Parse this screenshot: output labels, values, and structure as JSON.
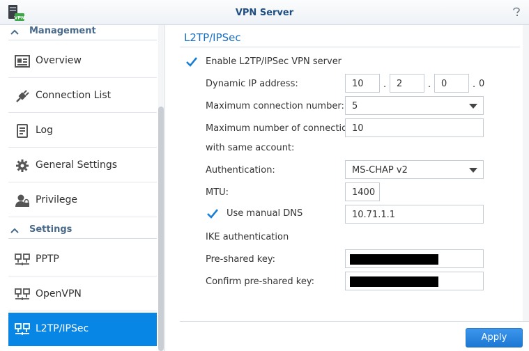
{
  "window": {
    "title": "VPN Server",
    "app_icon_text": "VPN"
  },
  "sidebar": {
    "groups": [
      {
        "label": "Management"
      },
      {
        "label": "Settings"
      }
    ],
    "items": [
      {
        "label": "Overview"
      },
      {
        "label": "Connection List"
      },
      {
        "label": "Log"
      },
      {
        "label": "General Settings"
      },
      {
        "label": "Privilege"
      },
      {
        "label": "PPTP"
      },
      {
        "label": "OpenVPN"
      },
      {
        "label": "L2TP/IPSec"
      }
    ],
    "active_item": "L2TP/IPSec"
  },
  "form": {
    "section_title": "L2TP/IPSec",
    "enable_label": "Enable L2TP/IPSec VPN server",
    "enable_checked": true,
    "dynamic_ip_label": "Dynamic IP address:",
    "ip_octets": [
      "10",
      "2",
      "0"
    ],
    "ip_last_octet": "0",
    "ip_separator": ".",
    "max_conn_label": "Maximum connection number:",
    "max_conn_value": "5",
    "max_same_label_1": "Maximum number of connections",
    "max_same_label_2": "with same account:",
    "max_same_value": "10",
    "auth_label": "Authentication:",
    "auth_value": "MS-CHAP v2",
    "mtu_label": "MTU:",
    "mtu_value": "1400",
    "manual_dns_label": "Use manual DNS",
    "manual_dns_checked": true,
    "dns_value": "10.71.1.1",
    "ike_label": "IKE authentication",
    "psk_label": "Pre-shared key:",
    "confirm_psk_label": "Confirm pre-shared key:",
    "apply_label": "Apply"
  },
  "colors": {
    "accent": "#0886e6",
    "title": "#1f4f82",
    "check": "#1a7fd4"
  }
}
